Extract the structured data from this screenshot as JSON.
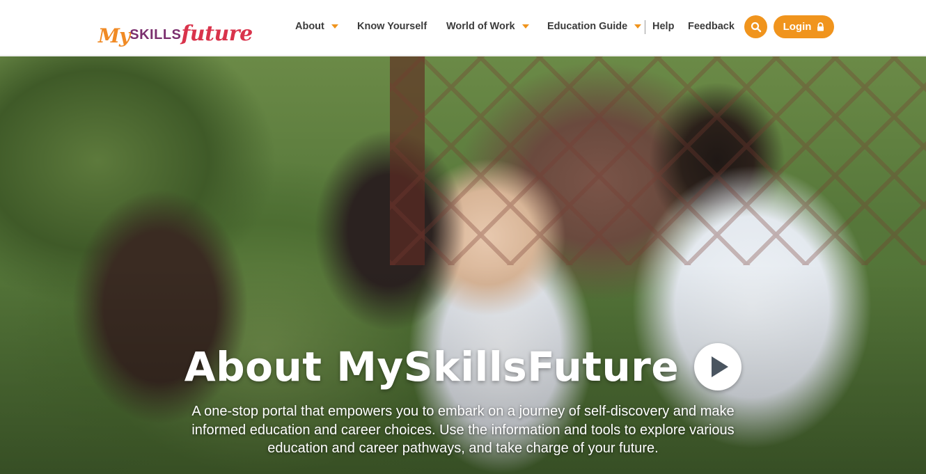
{
  "header": {
    "logo": {
      "my": "My",
      "skills": "SKILLS",
      "future": "future"
    },
    "nav": [
      {
        "label": "About",
        "has_dropdown": true
      },
      {
        "label": "Know Yourself",
        "has_dropdown": false
      },
      {
        "label": "World of Work",
        "has_dropdown": true
      },
      {
        "label": "Education Guide",
        "has_dropdown": true
      },
      {
        "label": "Help",
        "has_dropdown": false
      },
      {
        "label": "Feedback",
        "has_dropdown": false
      }
    ],
    "search_icon": "search-icon",
    "login_label": "Login",
    "login_icon": "lock-icon"
  },
  "hero": {
    "title": "About MySkillsFuture",
    "play_icon": "play-icon",
    "description": "A one-stop portal that empowers you to embark on a journey of self-discovery and make informed education and career choices. Use the information and tools to explore various education and career pathways, and take charge of your future."
  },
  "colors": {
    "accent": "#f0941d",
    "logo_orange": "#f08a24",
    "logo_purple": "#7b2f6e",
    "logo_red": "#d9334b",
    "nav_text": "#3b3b3b"
  }
}
